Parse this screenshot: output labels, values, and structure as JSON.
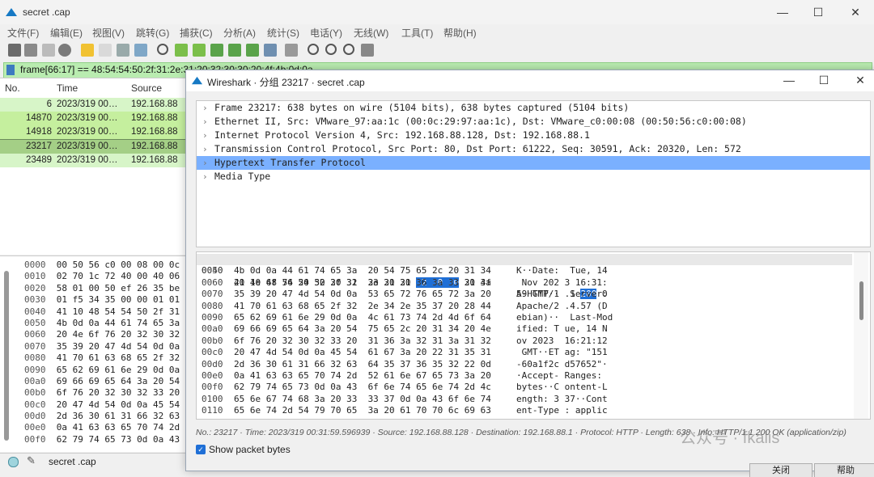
{
  "main": {
    "title": "secret .cap",
    "menu": [
      "文件(F)",
      "编辑(E)",
      "视图(V)",
      "跳转(G)",
      "捕获(C)",
      "分析(A)",
      "统计(S)",
      "电话(Y)",
      "无线(W)",
      "工具(T)",
      "帮助(H)"
    ],
    "filter": "frame[66:17] == 48:54:54:50:2f:31:2e:31:20:32:30:30:20:4f:4b:0d:0a",
    "columns": {
      "no": "No.",
      "time": "Time",
      "source": "Source"
    },
    "rows": [
      {
        "no": "6",
        "time": "2023/319 00…",
        "source": "192.168.88"
      },
      {
        "no": "14870",
        "time": "2023/319 00…",
        "source": "192.168.88"
      },
      {
        "no": "14918",
        "time": "2023/319 00…",
        "source": "192.168.88"
      },
      {
        "no": "23217",
        "time": "2023/319 00…",
        "source": "192.168.88"
      },
      {
        "no": "23489",
        "time": "2023/319 00…",
        "source": "192.168.88"
      }
    ],
    "hex": [
      {
        "off": "0000",
        "hex": "00 50 56 c0 00 08 00 0c"
      },
      {
        "off": "0010",
        "hex": "02 70 1c 72 40 00 40 06"
      },
      {
        "off": "0020",
        "hex": "58 01 00 50 ef 26 35 be"
      },
      {
        "off": "0030",
        "hex": "01 f5 34 35 00 00 01 01"
      },
      {
        "off": "0040",
        "hex": "41 10 48 54 54 50 2f 31"
      },
      {
        "off": "0050",
        "hex": "4b 0d 0a 44 61 74 65 3a"
      },
      {
        "off": "0060",
        "hex": "20 4e 6f 76 20 32 30 32"
      },
      {
        "off": "0070",
        "hex": "35 39 20 47 4d 54 0d 0a"
      },
      {
        "off": "0080",
        "hex": "41 70 61 63 68 65 2f 32"
      },
      {
        "off": "0090",
        "hex": "65 62 69 61 6e 29 0d 0a"
      },
      {
        "off": "00a0",
        "hex": "69 66 69 65 64 3a 20 54"
      },
      {
        "off": "00b0",
        "hex": "6f 76 20 32 30 32 33 20"
      },
      {
        "off": "00c0",
        "hex": "20 47 4d 54 0d 0a 45 54"
      },
      {
        "off": "00d0",
        "hex": "2d 36 30 61 31 66 32 63"
      },
      {
        "off": "00e0",
        "hex": "0a 41 63 63 65 70 74 2d"
      },
      {
        "off": "00f0",
        "hex": "62 79 74 65 73 0d 0a 43"
      }
    ],
    "status_file": "secret .cap"
  },
  "dialog": {
    "title": "Wireshark · 分组 23217 · secret .cap",
    "tree": [
      "Frame 23217: 638 bytes on wire (5104 bits), 638 bytes captured (5104 bits)",
      "Ethernet II, Src: VMware_97:aa:1c (00:0c:29:97:aa:1c), Dst: VMware_c0:00:08 (00:50:56:c0:00:08)",
      "Internet Protocol Version 4, Src: 192.168.88.128, Dst: 192.168.88.1",
      "Transmission Control Protocol, Src Port: 80, Dst Port: 61222, Seq: 30591, Ack: 20320, Len: 572",
      "Hypertext Transfer Protocol",
      "Media Type"
    ],
    "bytes": [
      {
        "off": "0040",
        "hex_a": "41 10 48 54 54 50 2f 31  2e 31 20 ",
        "hex_hl": "32 30 30",
        "hex_b": " 20 4f",
        "asc_a": "A·HTTP/1 .1 ",
        "asc_hl": "200",
        "asc_b": " O"
      },
      {
        "off": "0050",
        "hex": "4b 0d 0a 44 61 74 65 3a  20 54 75 65 2c 20 31 34",
        "asc": "K··Date:  Tue, 14"
      },
      {
        "off": "0060",
        "hex": "20 4e 6f 76 20 32 30 32  33 20 31 36 3a 33 31 3a",
        "asc": " Nov 202 3 16:31:"
      },
      {
        "off": "0070",
        "hex": "35 39 20 47 4d 54 0d 0a  53 65 72 76 65 72 3a 20",
        "asc": "59 GMT··  Server: "
      },
      {
        "off": "0080",
        "hex": "41 70 61 63 68 65 2f 32  2e 34 2e 35 37 20 28 44",
        "asc": "Apache/2 .4.57 (D"
      },
      {
        "off": "0090",
        "hex": "65 62 69 61 6e 29 0d 0a  4c 61 73 74 2d 4d 6f 64",
        "asc": "ebian)··  Last-Mod"
      },
      {
        "off": "00a0",
        "hex": "69 66 69 65 64 3a 20 54  75 65 2c 20 31 34 20 4e",
        "asc": "ified: T ue, 14 N"
      },
      {
        "off": "00b0",
        "hex": "6f 76 20 32 30 32 33 20  31 36 3a 32 31 3a 31 32",
        "asc": "ov 2023  16:21:12"
      },
      {
        "off": "00c0",
        "hex": "20 47 4d 54 0d 0a 45 54  61 67 3a 20 22 31 35 31",
        "asc": " GMT··ET ag: \"151"
      },
      {
        "off": "00d0",
        "hex": "2d 36 30 61 31 66 32 63  64 35 37 36 35 32 22 0d",
        "asc": "-60a1f2c d57652\"·"
      },
      {
        "off": "00e0",
        "hex": "0a 41 63 63 65 70 74 2d  52 61 6e 67 65 73 3a 20",
        "asc": "·Accept- Ranges: "
      },
      {
        "off": "00f0",
        "hex": "62 79 74 65 73 0d 0a 43  6f 6e 74 65 6e 74 2d 4c",
        "asc": "bytes··C ontent-L"
      },
      {
        "off": "0100",
        "hex": "65 6e 67 74 68 3a 20 33  33 37 0d 0a 43 6f 6e 74",
        "asc": "ength: 3 37··Cont"
      },
      {
        "off": "0110",
        "hex": "65 6e 74 2d 54 79 70 65  3a 20 61 70 70 6c 69 63",
        "asc": "ent-Type : applic"
      }
    ],
    "status": "No.: 23217 · Time: 2023/319 00:31:59.596939 · Source: 192.168.88.128 · Destination: 192.168.88.1 · Protocol: HTTP · Length: 638 · Info: HTTP/1.1 200 OK (application/zip)",
    "show_bytes": "Show packet bytes",
    "close_label": "关闭",
    "help_label": "帮助"
  },
  "watermark": "公众号 · fkalis"
}
